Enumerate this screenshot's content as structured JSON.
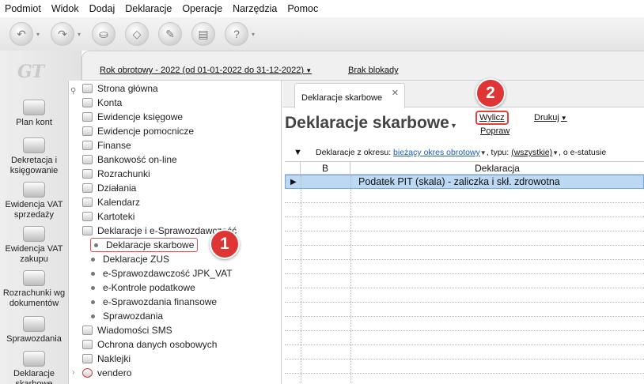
{
  "menu": [
    "Podmiot",
    "Widok",
    "Dodaj",
    "Deklaracje",
    "Operacje",
    "Narzędzia",
    "Pomoc"
  ],
  "toolbar": {
    "buttons": [
      "back-icon",
      "forward-icon",
      "stamp-icon",
      "eraser-icon",
      "tools-icon",
      "printer-icon",
      "help-icon"
    ]
  },
  "logo": "GT",
  "left_panel": [
    {
      "label": "Plan kont",
      "icon": "chart-of-accounts-icon"
    },
    {
      "label": "Dekretacja i księgowanie",
      "icon": "bookkeeping-icon"
    },
    {
      "label": "Ewidencja VAT sprzedaży",
      "icon": "vat-sales-icon"
    },
    {
      "label": "Ewidencja VAT zakupu",
      "icon": "vat-purchase-icon"
    },
    {
      "label": "Rozrachunki wg dokumentów",
      "icon": "settlements-icon"
    },
    {
      "label": "Sprawozdania",
      "icon": "reports-icon"
    },
    {
      "label": "Deklaracje skarbowe",
      "icon": "tax-declarations-icon"
    }
  ],
  "info": {
    "year": "Rok obrotowy - 2022  (od 01-01-2022 do 31-12-2022)",
    "lock": "Brak blokady"
  },
  "tree": {
    "items": [
      {
        "label": "Strona główna",
        "icon": "home-icon"
      },
      {
        "label": "Konta",
        "icon": "accounts-icon"
      },
      {
        "label": "Ewidencje księgowe",
        "icon": "ledger-icon"
      },
      {
        "label": "Ewidencje pomocnicze",
        "icon": "auxiliary-icon"
      },
      {
        "label": "Finanse",
        "icon": "finance-icon"
      },
      {
        "label": "Bankowość on-line",
        "icon": "bank-icon"
      },
      {
        "label": "Rozrachunki",
        "icon": "settlements-icon"
      },
      {
        "label": "Działania",
        "icon": "actions-icon"
      },
      {
        "label": "Kalendarz",
        "icon": "calendar-icon"
      },
      {
        "label": "Kartoteki",
        "icon": "cards-icon"
      },
      {
        "label": "Deklaracje i e-Sprawozdawczość",
        "icon": "declarations-icon"
      }
    ],
    "subitems": [
      {
        "label": "Deklaracje skarbowe",
        "selected": true
      },
      {
        "label": "Deklaracje ZUS"
      },
      {
        "label": "e-Sprawozdawczość JPK_VAT"
      },
      {
        "label": "e-Kontrole podatkowe"
      },
      {
        "label": "e-Sprawozdania finansowe"
      },
      {
        "label": "Sprawozdania"
      }
    ],
    "items_after": [
      {
        "label": "Wiadomości SMS",
        "icon": "sms-icon"
      },
      {
        "label": "Ochrona danych osobowych",
        "icon": "data-protection-icon"
      },
      {
        "label": "Naklejki",
        "icon": "stickers-icon"
      },
      {
        "label": "vendero",
        "icon": "vendero-icon"
      }
    ]
  },
  "tab": {
    "label": "Deklaracje skarbowe",
    "close": "✕"
  },
  "title": "Deklaracje skarbowe",
  "actions": {
    "calc": "Wylicz",
    "fix": "Popraw",
    "print": "Drukuj"
  },
  "filter": {
    "prefix": "Deklaracje z okresu:",
    "period": "bieżący okres obrotowy",
    "type_label": ", typu:",
    "type": "(wszystkie)",
    "status_label": ", o e-statusie"
  },
  "grid": {
    "columns": [
      "B",
      "Deklaracja"
    ],
    "rows": [
      {
        "declaration": "Podatek PIT (skala) - zaliczka i skł. zdrowotna"
      }
    ]
  },
  "callouts": [
    "1",
    "2"
  ]
}
